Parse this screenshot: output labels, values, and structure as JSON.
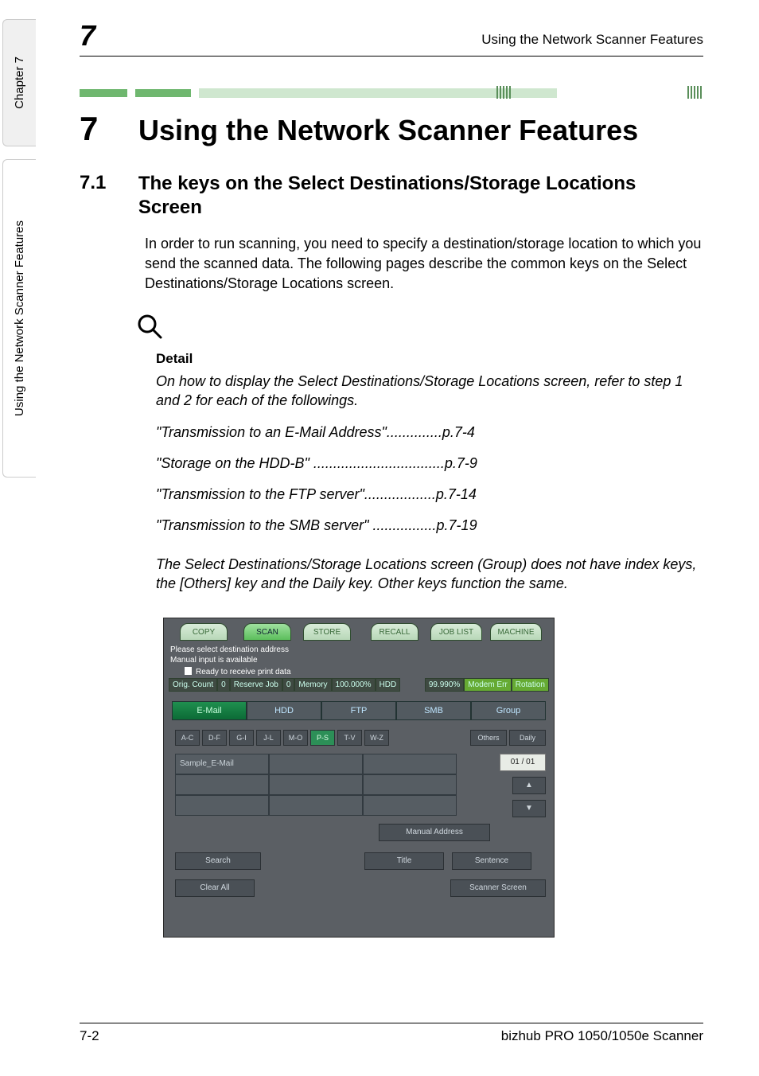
{
  "side_tabs": {
    "chapter": "Chapter 7",
    "section": "Using the Network Scanner Features"
  },
  "running_head": {
    "chapter_no": "7",
    "title": "Using the Network Scanner Features"
  },
  "h1": {
    "no": "7",
    "text": "Using the Network Scanner Features"
  },
  "h2": {
    "no": "7.1",
    "text": "The keys on the Select Destinations/Storage Locations Screen"
  },
  "intro": "In order to run scanning, you need to specify a destination/storage location to which you send the scanned data. The following pages describe the common keys on the Select Destinations/Storage Locations screen.",
  "detail": {
    "heading": "Detail",
    "lead": "On how to display the Select Destinations/Storage Locations screen, refer to step 1 and 2 for each of the followings.",
    "refs": [
      "\"Transmission to an E-Mail Address\"..............p.7-4",
      "\"Storage on the HDD-B\" .................................p.7-9",
      "\"Transmission to the FTP server\"..................p.7-14",
      "\"Transmission to the SMB server\" ................p.7-19"
    ],
    "note": "The Select Destinations/Storage Locations screen (Group) does not have index keys, the [Others] key and the Daily key. Other keys function the same."
  },
  "screenshot": {
    "top_tabs": {
      "copy": "COPY",
      "scan": "SCAN",
      "store": "STORE",
      "recall": "RECALL",
      "joblist": "JOB LIST",
      "machine": "MACHINE"
    },
    "msg1": "Please select destination address",
    "msg2": "Manual input is available",
    "status_line": "Ready to receive print data",
    "counters": {
      "orig_count_lbl": "Orig. Count",
      "orig_count_val": "0",
      "reserve_lbl": "Reserve Job",
      "reserve_val": "0",
      "memory_lbl": "Memory",
      "memory_val": "100.000%",
      "hdd_lbl": "HDD",
      "hdd_val": "99.990%",
      "modem": "Modem Err",
      "rotation": "Rotation"
    },
    "categories": {
      "email": "E-Mail",
      "hdd": "HDD",
      "ftp": "FTP",
      "smb": "SMB",
      "group": "Group"
    },
    "index": [
      "A-C",
      "D-F",
      "G-I",
      "J-L",
      "M-O",
      "P-S",
      "T-V",
      "W-Z"
    ],
    "others": "Others",
    "daily": "Daily",
    "sample": "Sample_E-Mail",
    "pager": "01 / 01",
    "manual": "Manual Address",
    "search": "Search",
    "title": "Title",
    "sentence": "Sentence",
    "clear": "Clear All",
    "scanner_screen": "Scanner Screen"
  },
  "footer": {
    "left": "7-2",
    "right": "bizhub PRO 1050/1050e Scanner"
  }
}
